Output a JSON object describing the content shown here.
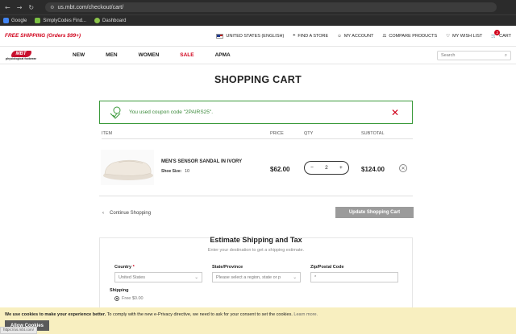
{
  "browser": {
    "url": "us.mbt.com/checkout/cart/",
    "bookmarks": [
      {
        "label": "Google",
        "color": "#4285f4"
      },
      {
        "label": "SimplyCodes Find...",
        "color": "#7bc043"
      },
      {
        "label": "Dashboard",
        "color": "#8bc34a"
      }
    ]
  },
  "promo": {
    "free_shipping": "FREE SHIPPING (Orders $99+)",
    "region": "UNITED STATES (ENGLISH)",
    "find_store": "FIND A STORE",
    "my_account": "MY ACCOUNT",
    "compare": "COMPARE PRODUCTS",
    "wishlist": "MY WISH LIST",
    "cart": "CART",
    "cart_count": "2"
  },
  "nav": {
    "logo": "MBT",
    "logo_sub": "physiological footwear",
    "links": [
      "NEW",
      "MEN",
      "WOMEN",
      "SALE",
      "APMA"
    ],
    "search_placeholder": "Search"
  },
  "page": {
    "title": "SHOPPING CART",
    "coupon_msg": "You used coupon code \"2PAIRS25\".",
    "headers": {
      "item": "ITEM",
      "price": "PRICE",
      "qty": "QTY",
      "subtotal": "SUBTOTAL"
    },
    "item": {
      "name": "MEN'S SENSOR SANDAL IN IVORY",
      "size_label": "Shoe Size:",
      "size": "10",
      "price": "$62.00",
      "qty": "2",
      "subtotal": "$124.00"
    },
    "continue": "Continue Shopping",
    "update": "Update Shopping Cart"
  },
  "estimate": {
    "title": "Estimate Shipping and Tax",
    "hint": "Enter your destination to get a shipping estimate.",
    "country_label": "Country",
    "country_value": "United States",
    "state_label": "State/Province",
    "state_value": "Please select a region, state or p",
    "zip_label": "Zip/Postal Code",
    "zip_value": "*",
    "shipping_label": "Shipping",
    "shipping_option": "Free $0.00"
  },
  "cookie": {
    "bold": "We use cookies to make your experience better.",
    "text": " To comply with the new e-Privacy directive, we need to ask for your consent to set the cookies.",
    "learn": "Learn more.",
    "allow": "Allow Cookies",
    "status_url": "https://us.mbt.com/"
  },
  "colors": {
    "accent": "#d0021b",
    "success": "#3b9a3b",
    "cookie_bg": "#f8efc0"
  }
}
